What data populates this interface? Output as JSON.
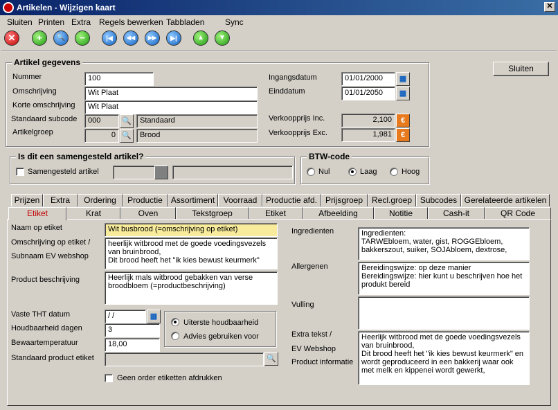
{
  "window": {
    "title": "Artikelen - Wijzigen kaart",
    "close": "✕"
  },
  "menu": [
    "Sluiten",
    "Printen",
    "Extra",
    "Regels bewerken",
    "Tabbladen",
    "Sync"
  ],
  "toolbar": {
    "close": "✕",
    "add": "+",
    "search": "🔍",
    "remove": "−",
    "first": "|◀",
    "prev": "◀◀",
    "next": "▶▶",
    "last": "▶|",
    "up": "▲",
    "down": "▼"
  },
  "sluiten_button": "Sluiten",
  "artikel": {
    "title": "Artikel gegevens",
    "nummer_label": "Nummer",
    "nummer": "100",
    "omschrijving_label": "Omschrijving",
    "omschrijving": "Wit Plaat",
    "korte_label": "Korte omschrijving",
    "korte": "Wit Plaat",
    "subcode_label": "Standaard subcode",
    "subcode": "000",
    "subcode_name": "Standaard",
    "groep_label": "Artikelgroep",
    "groep": "0",
    "groep_name": "Brood",
    "ingang_label": "Ingangsdatum",
    "ingang": "01/01/2000",
    "eind_label": "Einddatum",
    "eind": "01/01/2050",
    "vk_inc_label": "Verkoopprijs Inc.",
    "vk_inc": "2,100",
    "vk_exc_label": "Verkoopprijs Exc.",
    "vk_exc": "1,981",
    "euro": "€",
    "cal": "▦",
    "search": "🔍"
  },
  "samengesteld": {
    "title": "Is dit een samengesteld artikel?",
    "label": "Samengesteld artikel"
  },
  "btw": {
    "title": "BTW-code",
    "options": [
      "Nul",
      "Laag",
      "Hoog"
    ]
  },
  "tabs_row1": [
    "Prijzen",
    "Extra",
    "Ordering",
    "Productie",
    "Assortiment",
    "Voorraad",
    "Productie afd.",
    "Prijsgroep",
    "Recl.groep",
    "Subcodes",
    "Gerelateerde artikelen"
  ],
  "tabs_row2": [
    "Etiket",
    "Krat",
    "Oven",
    "Tekstgroep",
    "Etiket",
    "Afbeelding",
    "Notitie",
    "Cash-it",
    "QR Code"
  ],
  "etiket": {
    "naam_label": "Naam op etiket",
    "naam": "Wit busbrood (=omschrijving op etiket)",
    "omschr_label1": "Omschrijving op etiket /",
    "omschr_label2": "Subnaam EV webshop",
    "omschr": "heerlijk witbrood met de goede voedingsvezels van bruinbrood,\nDit brood heeft het \"ik kies bewust keurmerk\"",
    "beschr_label": "Product beschrijving",
    "beschr": "Heerlijk mals witbrood gebakken van verse broodbloem (=productbeschrijving)",
    "tht_label": "Vaste THT datum",
    "tht": " /  /",
    "houdbaar_label": "Houdbaarheid dagen",
    "houdbaar": "3",
    "temp_label": "Bewaartemperatuur",
    "temp": "18,00",
    "std_label": "Standaard product etiket",
    "radio1": "Uiterste houdbaarheid",
    "radio2": "Advies gebruiken voor",
    "noorder": "Geen order etiketten afdrukken",
    "ingr_label": "Ingredienten",
    "ingr": "Ingredienten:\nTARWEbloem, water, gist, ROGGEbloem,\nbakkerszout, suiker, SOJAbloem, dextrose,",
    "allerg_label": "Allergenen",
    "allerg": "Bereidingswijze: op deze manier\nBereidingswijze: hier kunt u beschrijven hoe het produkt bereid",
    "vulling_label": "Vulling",
    "vulling": "",
    "extra_label1": "Extra tekst /",
    "extra_label2": "EV Webshop",
    "extra_label3": "Product informatie",
    "extra": "Heerlijk witbrood met de goede voedingsvezels van bruinbrood,\nDit brood heeft het \"ik kies bewust keurmerk\" en wordt geproduceerd in een bakkerij waar ook met melk en kippenei wordt gewerkt,"
  }
}
